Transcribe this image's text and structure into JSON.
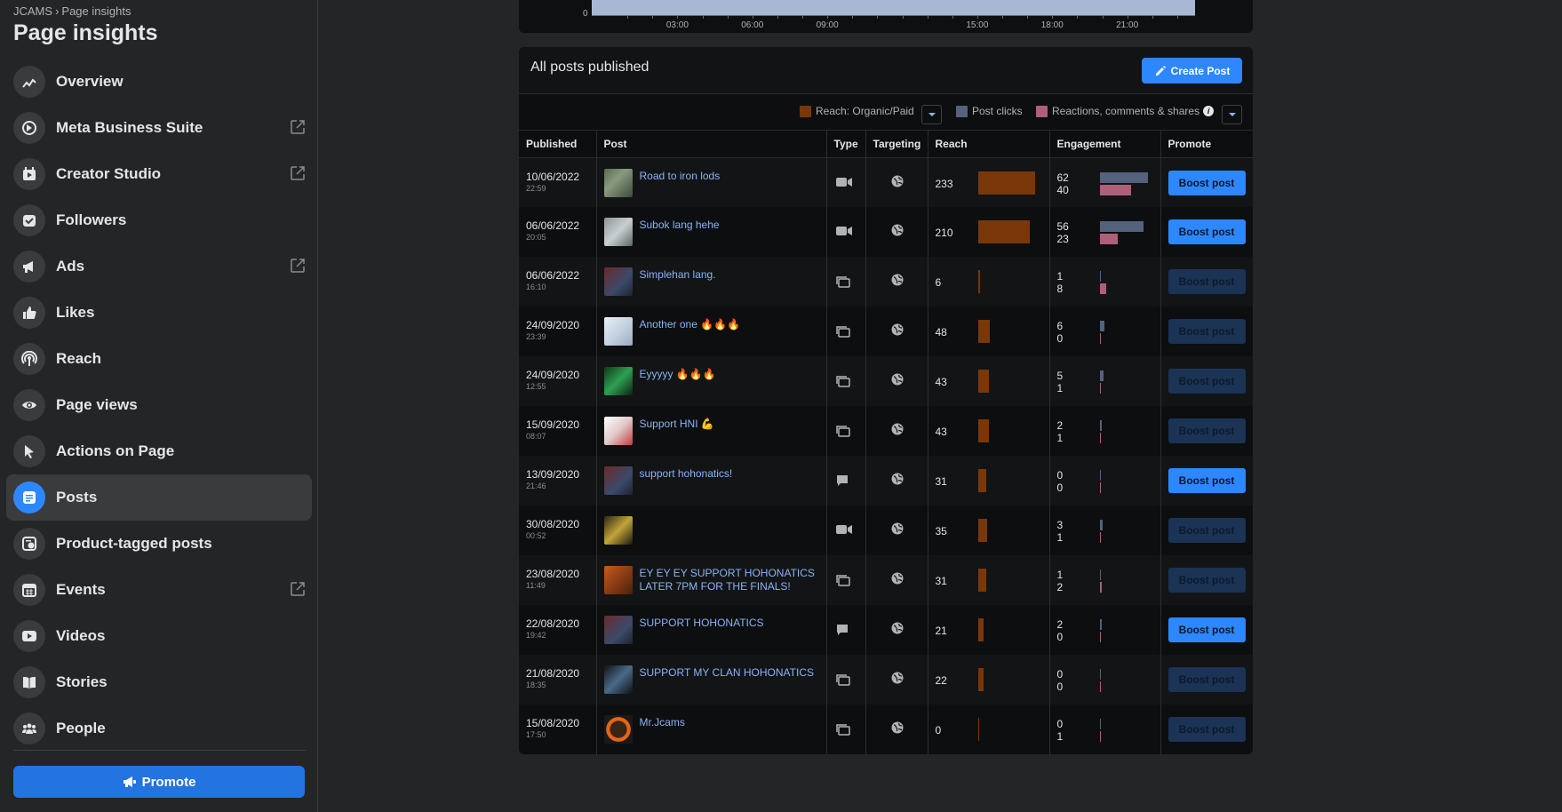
{
  "sidebar": {
    "breadcrumb": {
      "account": "JCAMS",
      "separator": "›",
      "page": "Page insights"
    },
    "title": "Page insights",
    "items": [
      {
        "label": "Overview",
        "icon": "overview-trend-icon",
        "external": false,
        "active": false
      },
      {
        "label": "Meta Business Suite",
        "icon": "meta-business-suite-icon",
        "external": true,
        "active": false
      },
      {
        "label": "Creator Studio",
        "icon": "creator-studio-icon",
        "external": true,
        "active": false
      },
      {
        "label": "Followers",
        "icon": "followers-icon",
        "external": false,
        "active": false
      },
      {
        "label": "Ads",
        "icon": "megaphone-icon",
        "external": true,
        "active": false
      },
      {
        "label": "Likes",
        "icon": "thumbs-up-icon",
        "external": false,
        "active": false
      },
      {
        "label": "Reach",
        "icon": "broadcast-icon",
        "external": false,
        "active": false
      },
      {
        "label": "Page views",
        "icon": "eye-icon",
        "external": false,
        "active": false
      },
      {
        "label": "Actions on Page",
        "icon": "cursor-icon",
        "external": false,
        "active": false
      },
      {
        "label": "Posts",
        "icon": "posts-icon",
        "external": false,
        "active": true
      },
      {
        "label": "Product-tagged posts",
        "icon": "product-tag-icon",
        "external": false,
        "active": false
      },
      {
        "label": "Events",
        "icon": "calendar-icon",
        "external": true,
        "active": false
      },
      {
        "label": "Videos",
        "icon": "video-play-icon",
        "external": false,
        "active": false
      },
      {
        "label": "Stories",
        "icon": "book-icon",
        "external": false,
        "active": false
      },
      {
        "label": "People",
        "icon": "people-icon",
        "external": false,
        "active": false
      }
    ],
    "promote_label": "Promote"
  },
  "chart_top": {
    "zero": "0",
    "ticks": [
      "03:00",
      "06:00",
      "09:00",
      "15:00",
      "18:00",
      "21:00"
    ]
  },
  "posts_card": {
    "title": "All posts published",
    "create_post_label": "Create Post",
    "legend": {
      "reach_label": "Reach: Organic/Paid",
      "clicks_label": "Post clicks",
      "reactions_label": "Reactions, comments & shares",
      "info": "i"
    },
    "columns": [
      "Published",
      "Post",
      "Type",
      "Targeting",
      "Reach",
      "Engagement",
      "Promote"
    ],
    "colors": {
      "reach": "#7a3709",
      "clicks": "#55627e",
      "reactions": "#b05f7a",
      "accent": "#2d88ff"
    },
    "rows": [
      {
        "date": "10/06/2022",
        "time": "22:59",
        "post": "Road to iron lods",
        "type": "video",
        "reach": "233",
        "clicks": "62",
        "reactions": "40",
        "boost_label": "Boost post",
        "boost_enabled": true
      },
      {
        "date": "06/06/2022",
        "time": "20:05",
        "post": "Subok lang hehe",
        "type": "video",
        "reach": "210",
        "clicks": "56",
        "reactions": "23",
        "boost_label": "Boost post",
        "boost_enabled": true
      },
      {
        "date": "06/06/2022",
        "time": "16:10",
        "post": "Simplehan lang.",
        "type": "album",
        "reach": "6",
        "clicks": "1",
        "reactions": "8",
        "boost_label": "Boost post",
        "boost_enabled": false
      },
      {
        "date": "24/09/2020",
        "time": "23:39",
        "post": "Another one 🔥🔥🔥",
        "type": "album",
        "reach": "48",
        "clicks": "6",
        "reactions": "0",
        "boost_label": "Boost post",
        "boost_enabled": false
      },
      {
        "date": "24/09/2020",
        "time": "12:55",
        "post": "Eyyyyy 🔥🔥🔥",
        "type": "album",
        "reach": "43",
        "clicks": "5",
        "reactions": "1",
        "boost_label": "Boost post",
        "boost_enabled": false
      },
      {
        "date": "15/09/2020",
        "time": "08:07",
        "post": "Support HNI 💪",
        "type": "album",
        "reach": "43",
        "clicks": "2",
        "reactions": "1",
        "boost_label": "Boost post",
        "boost_enabled": false
      },
      {
        "date": "13/09/2020",
        "time": "21:46",
        "post": "support hohonatics!",
        "type": "status",
        "reach": "31",
        "clicks": "0",
        "reactions": "0",
        "boost_label": "Boost post",
        "boost_enabled": true
      },
      {
        "date": "30/08/2020",
        "time": "00:52",
        "post": "",
        "type": "video",
        "reach": "35",
        "clicks": "3",
        "reactions": "1",
        "boost_label": "Boost post",
        "boost_enabled": false
      },
      {
        "date": "23/08/2020",
        "time": "11:49",
        "post": "EY EY EY SUPPORT HOHONATICS LATER 7PM FOR THE FINALS!",
        "type": "album",
        "reach": "31",
        "clicks": "1",
        "reactions": "2",
        "boost_label": "Boost post",
        "boost_enabled": false
      },
      {
        "date": "22/08/2020",
        "time": "19:42",
        "post": "SUPPORT HOHONATICS",
        "type": "status",
        "reach": "21",
        "clicks": "2",
        "reactions": "0",
        "boost_label": "Boost post",
        "boost_enabled": true
      },
      {
        "date": "21/08/2020",
        "time": "18:35",
        "post": "SUPPORT MY CLAN HOHONATICS",
        "type": "album",
        "reach": "22",
        "clicks": "0",
        "reactions": "0",
        "boost_label": "Boost post",
        "boost_enabled": false
      },
      {
        "date": "15/08/2020",
        "time": "17:50",
        "post": "Mr.Jcams",
        "type": "album",
        "reach": "0",
        "clicks": "0",
        "reactions": "1",
        "boost_label": "Boost post",
        "boost_enabled": false
      }
    ]
  }
}
